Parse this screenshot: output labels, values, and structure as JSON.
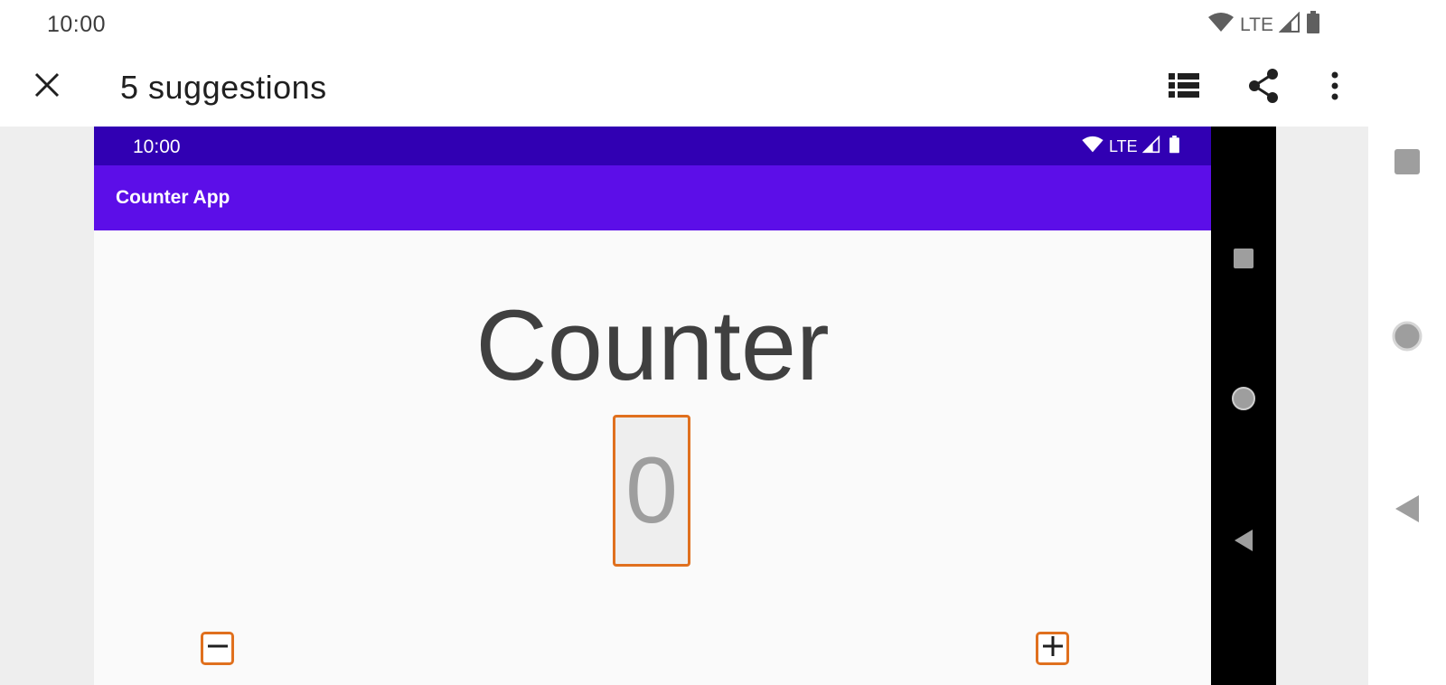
{
  "status_bar": {
    "time": "10:00",
    "network": "LTE",
    "icons": [
      "wifi-icon",
      "signal-icon",
      "battery-icon"
    ]
  },
  "toolbar": {
    "title": "5 suggestions",
    "actions": [
      "close-icon",
      "list-view-icon",
      "share-icon",
      "more-options-icon"
    ]
  },
  "device": {
    "status_bar": {
      "time": "10:00",
      "network": "LTE"
    },
    "app_bar": {
      "title": "Counter App",
      "color": "#5c0ee8",
      "status_color": "#3100b3"
    },
    "heading": "Counter",
    "counter_value": "0",
    "buttons": {
      "decrement": "minus-icon",
      "increment": "plus-icon"
    },
    "nav": [
      "recents-square-icon",
      "home-circle-icon",
      "back-triangle-icon"
    ],
    "highlight_color": "#e0701e"
  },
  "right_rail": {
    "nav": [
      "recents-square-icon",
      "home-circle-icon",
      "back-triangle-icon"
    ]
  }
}
